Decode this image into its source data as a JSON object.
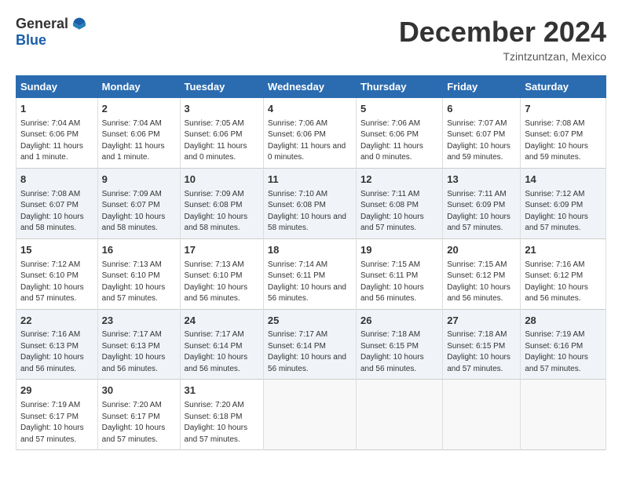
{
  "logo": {
    "general": "General",
    "blue": "Blue"
  },
  "title": "December 2024",
  "location": "Tzintzuntzan, Mexico",
  "days_header": [
    "Sunday",
    "Monday",
    "Tuesday",
    "Wednesday",
    "Thursday",
    "Friday",
    "Saturday"
  ],
  "weeks": [
    [
      {
        "num": "1",
        "sunrise": "Sunrise: 7:04 AM",
        "sunset": "Sunset: 6:06 PM",
        "daylight": "Daylight: 11 hours and 1 minute."
      },
      {
        "num": "2",
        "sunrise": "Sunrise: 7:04 AM",
        "sunset": "Sunset: 6:06 PM",
        "daylight": "Daylight: 11 hours and 1 minute."
      },
      {
        "num": "3",
        "sunrise": "Sunrise: 7:05 AM",
        "sunset": "Sunset: 6:06 PM",
        "daylight": "Daylight: 11 hours and 0 minutes."
      },
      {
        "num": "4",
        "sunrise": "Sunrise: 7:06 AM",
        "sunset": "Sunset: 6:06 PM",
        "daylight": "Daylight: 11 hours and 0 minutes."
      },
      {
        "num": "5",
        "sunrise": "Sunrise: 7:06 AM",
        "sunset": "Sunset: 6:06 PM",
        "daylight": "Daylight: 11 hours and 0 minutes."
      },
      {
        "num": "6",
        "sunrise": "Sunrise: 7:07 AM",
        "sunset": "Sunset: 6:07 PM",
        "daylight": "Daylight: 10 hours and 59 minutes."
      },
      {
        "num": "7",
        "sunrise": "Sunrise: 7:08 AM",
        "sunset": "Sunset: 6:07 PM",
        "daylight": "Daylight: 10 hours and 59 minutes."
      }
    ],
    [
      {
        "num": "8",
        "sunrise": "Sunrise: 7:08 AM",
        "sunset": "Sunset: 6:07 PM",
        "daylight": "Daylight: 10 hours and 58 minutes."
      },
      {
        "num": "9",
        "sunrise": "Sunrise: 7:09 AM",
        "sunset": "Sunset: 6:07 PM",
        "daylight": "Daylight: 10 hours and 58 minutes."
      },
      {
        "num": "10",
        "sunrise": "Sunrise: 7:09 AM",
        "sunset": "Sunset: 6:08 PM",
        "daylight": "Daylight: 10 hours and 58 minutes."
      },
      {
        "num": "11",
        "sunrise": "Sunrise: 7:10 AM",
        "sunset": "Sunset: 6:08 PM",
        "daylight": "Daylight: 10 hours and 58 minutes."
      },
      {
        "num": "12",
        "sunrise": "Sunrise: 7:11 AM",
        "sunset": "Sunset: 6:08 PM",
        "daylight": "Daylight: 10 hours and 57 minutes."
      },
      {
        "num": "13",
        "sunrise": "Sunrise: 7:11 AM",
        "sunset": "Sunset: 6:09 PM",
        "daylight": "Daylight: 10 hours and 57 minutes."
      },
      {
        "num": "14",
        "sunrise": "Sunrise: 7:12 AM",
        "sunset": "Sunset: 6:09 PM",
        "daylight": "Daylight: 10 hours and 57 minutes."
      }
    ],
    [
      {
        "num": "15",
        "sunrise": "Sunrise: 7:12 AM",
        "sunset": "Sunset: 6:10 PM",
        "daylight": "Daylight: 10 hours and 57 minutes."
      },
      {
        "num": "16",
        "sunrise": "Sunrise: 7:13 AM",
        "sunset": "Sunset: 6:10 PM",
        "daylight": "Daylight: 10 hours and 57 minutes."
      },
      {
        "num": "17",
        "sunrise": "Sunrise: 7:13 AM",
        "sunset": "Sunset: 6:10 PM",
        "daylight": "Daylight: 10 hours and 56 minutes."
      },
      {
        "num": "18",
        "sunrise": "Sunrise: 7:14 AM",
        "sunset": "Sunset: 6:11 PM",
        "daylight": "Daylight: 10 hours and 56 minutes."
      },
      {
        "num": "19",
        "sunrise": "Sunrise: 7:15 AM",
        "sunset": "Sunset: 6:11 PM",
        "daylight": "Daylight: 10 hours and 56 minutes."
      },
      {
        "num": "20",
        "sunrise": "Sunrise: 7:15 AM",
        "sunset": "Sunset: 6:12 PM",
        "daylight": "Daylight: 10 hours and 56 minutes."
      },
      {
        "num": "21",
        "sunrise": "Sunrise: 7:16 AM",
        "sunset": "Sunset: 6:12 PM",
        "daylight": "Daylight: 10 hours and 56 minutes."
      }
    ],
    [
      {
        "num": "22",
        "sunrise": "Sunrise: 7:16 AM",
        "sunset": "Sunset: 6:13 PM",
        "daylight": "Daylight: 10 hours and 56 minutes."
      },
      {
        "num": "23",
        "sunrise": "Sunrise: 7:17 AM",
        "sunset": "Sunset: 6:13 PM",
        "daylight": "Daylight: 10 hours and 56 minutes."
      },
      {
        "num": "24",
        "sunrise": "Sunrise: 7:17 AM",
        "sunset": "Sunset: 6:14 PM",
        "daylight": "Daylight: 10 hours and 56 minutes."
      },
      {
        "num": "25",
        "sunrise": "Sunrise: 7:17 AM",
        "sunset": "Sunset: 6:14 PM",
        "daylight": "Daylight: 10 hours and 56 minutes."
      },
      {
        "num": "26",
        "sunrise": "Sunrise: 7:18 AM",
        "sunset": "Sunset: 6:15 PM",
        "daylight": "Daylight: 10 hours and 56 minutes."
      },
      {
        "num": "27",
        "sunrise": "Sunrise: 7:18 AM",
        "sunset": "Sunset: 6:15 PM",
        "daylight": "Daylight: 10 hours and 57 minutes."
      },
      {
        "num": "28",
        "sunrise": "Sunrise: 7:19 AM",
        "sunset": "Sunset: 6:16 PM",
        "daylight": "Daylight: 10 hours and 57 minutes."
      }
    ],
    [
      {
        "num": "29",
        "sunrise": "Sunrise: 7:19 AM",
        "sunset": "Sunset: 6:17 PM",
        "daylight": "Daylight: 10 hours and 57 minutes."
      },
      {
        "num": "30",
        "sunrise": "Sunrise: 7:20 AM",
        "sunset": "Sunset: 6:17 PM",
        "daylight": "Daylight: 10 hours and 57 minutes."
      },
      {
        "num": "31",
        "sunrise": "Sunrise: 7:20 AM",
        "sunset": "Sunset: 6:18 PM",
        "daylight": "Daylight: 10 hours and 57 minutes."
      },
      null,
      null,
      null,
      null
    ]
  ]
}
